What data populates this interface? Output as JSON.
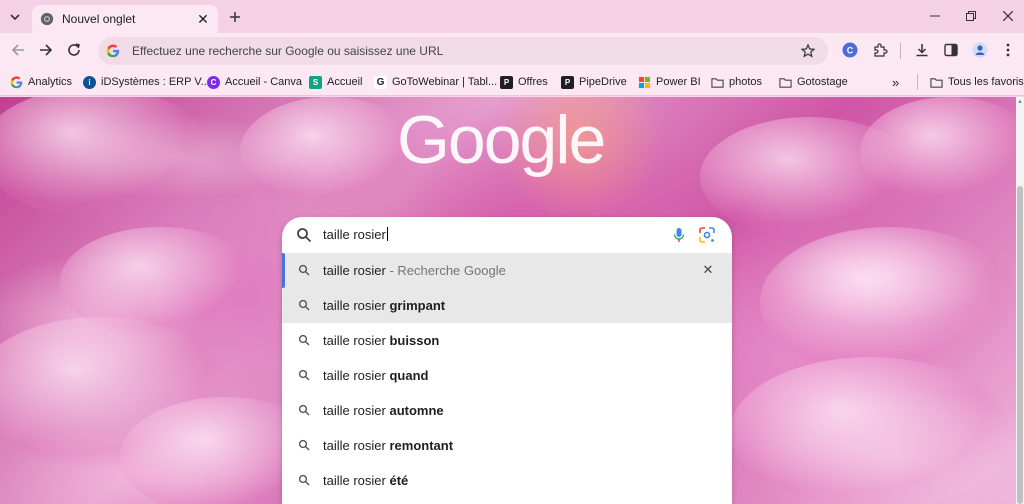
{
  "tab": {
    "title": "Nouvel onglet",
    "close_glyph": "✕"
  },
  "toolbar": {
    "omnibox_text": "Effectuez une recherche sur Google ou saisissez une URL"
  },
  "bookmarks": [
    {
      "label": "Analytics",
      "icon": "google-g-icon",
      "color": "#4285f4"
    },
    {
      "label": "iDSystèmes : ERP V...",
      "icon": "idsystemes-icon",
      "color": "#0b5394"
    },
    {
      "label": "Accueil - Canva",
      "icon": "canva-icon",
      "color": "#7d2ae8"
    },
    {
      "label": "Accueil",
      "icon": "accueil-icon",
      "color": "#14a085"
    },
    {
      "label": "GoToWebinar | Tabl...",
      "icon": "gotowebinar-icon",
      "color": "#1f1f1f"
    },
    {
      "label": "Offres",
      "icon": "offres-icon",
      "color": "#1f1f1f"
    },
    {
      "label": "PipeDrive",
      "icon": "pipedrive-icon",
      "color": "#1f1f1f"
    },
    {
      "label": "Power BI",
      "icon": "powerbi-icon",
      "color": "#f2c811"
    },
    {
      "label": "photos",
      "icon": "folder-icon",
      "color": "#444444"
    },
    {
      "label": "Gotostage",
      "icon": "folder-icon",
      "color": "#444444"
    }
  ],
  "bookmarks_more": "»",
  "bookmarks_all": "Tous les favoris",
  "google_logo": "Google",
  "search": {
    "query": "taille rosier",
    "suggestions": [
      {
        "prefix": "taille rosier",
        "suffix": "",
        "muted": " - Recherche Google",
        "state": "selected"
      },
      {
        "prefix": "taille rosier",
        "suffix": "grimpant",
        "muted": "",
        "state": "hover"
      },
      {
        "prefix": "taille rosier",
        "suffix": "buisson",
        "muted": "",
        "state": ""
      },
      {
        "prefix": "taille rosier",
        "suffix": "quand",
        "muted": "",
        "state": ""
      },
      {
        "prefix": "taille rosier",
        "suffix": "automne",
        "muted": "",
        "state": ""
      },
      {
        "prefix": "taille rosier",
        "suffix": "remontant",
        "muted": "",
        "state": ""
      },
      {
        "prefix": "taille rosier",
        "suffix": "été",
        "muted": "",
        "state": ""
      }
    ],
    "remove_glyph": "✕"
  },
  "colors": {
    "tabstrip_bg": "#f4d1e4",
    "toolbar_bg": "#fbe8f2",
    "selection_bar": "#4a73d6"
  }
}
